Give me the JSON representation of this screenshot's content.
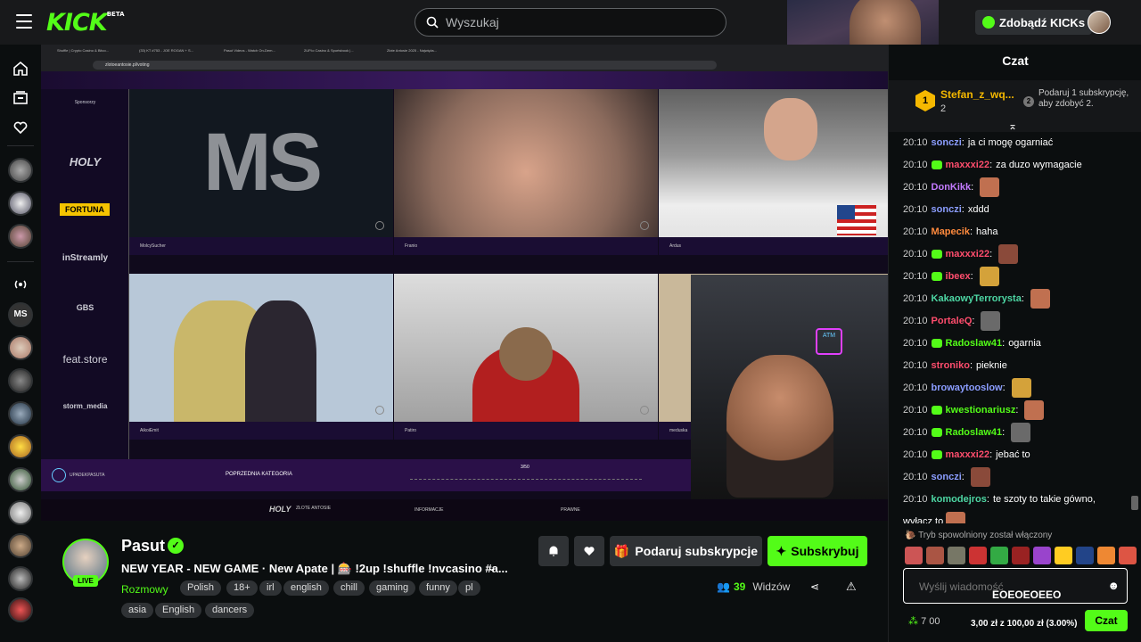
{
  "header": {
    "logo": "KICK",
    "logo_beta": "BETA",
    "search_placeholder": "Wyszukaj",
    "get_kicks": "Zdobądź KICKs"
  },
  "browser": {
    "tabs": [
      "Shuffle | Crypto Casino & Bitco...",
      "(33) KT #753 - JOE ROGAN + S...",
      "Pasut Videos - Watch On-Dem...",
      "2UP.io Casino & Sportsbook |...",
      "Złote Antosie 2025 - Najwięks..."
    ],
    "url": "zlotoeantosie.pl/voting"
  },
  "stream": {
    "sponsors_label": "Sponsorzy",
    "sponsors": [
      "HOLY",
      "FORTUNA",
      "inStreamly",
      "GBS",
      "feat.store",
      "storm_media"
    ],
    "big_logo": "MS",
    "cells": [
      "MolcySucher",
      "Franio",
      "Ardus",
      "AikoiEmit",
      "Patiro",
      "meduska"
    ],
    "prev_category": "POPRZEDNIA KATEGORIA",
    "page": "3/50",
    "channel_tag": "UPADEKPASUTA",
    "footer_info": "INFORMACJE",
    "footer_legal": "PRAWNE",
    "footer_logo": "HOLY",
    "footer_logo2": "ZŁOTE ANTOSIE"
  },
  "channel": {
    "name": "Pasut",
    "live": "LIVE",
    "title": "NEW YEAR - NEW GAME · New Apate | 🎰 !2up !shuffle !nvcasino #a...",
    "category": "Rozmowy",
    "tags": [
      "Polish",
      "18+",
      "irl",
      "english",
      "chill",
      "gaming",
      "funny",
      "pl",
      "asia",
      "English",
      "dancers"
    ],
    "gift_sub": "Podaruj subskrypcje",
    "subscribe": "Subskrybuj",
    "viewers_count": "39",
    "viewers_label": "Widzów"
  },
  "chat": {
    "title": "Czat",
    "pinned_user": "Stefan_z_wq...",
    "pinned_count": "2",
    "pinned_rank": "1",
    "pinned_gift": "Podaruj 1 subskrypcję, aby zdobyć 2.",
    "pinned_gift_badge": "2",
    "messages": [
      {
        "time": "20:10",
        "user": "sonczi",
        "color": "#8b9dff",
        "text": "ja ci mogę ogarniać",
        "emote": false,
        "badge": false
      },
      {
        "time": "20:10",
        "user": "maxxxi22",
        "color": "#ff4d6d",
        "text": "za duzo wymagacie",
        "emote": false,
        "badge": true
      },
      {
        "time": "20:10",
        "user": "DonKikk",
        "color": "#c47bff",
        "text": "",
        "emote": true,
        "badge": false
      },
      {
        "time": "20:10",
        "user": "sonczi",
        "color": "#8b9dff",
        "text": "xddd",
        "emote": false,
        "badge": false
      },
      {
        "time": "20:10",
        "user": "Mapecik",
        "color": "#ff8a3d",
        "text": "haha",
        "emote": false,
        "badge": false
      },
      {
        "time": "20:10",
        "user": "maxxxi22",
        "color": "#ff4d6d",
        "text": "",
        "emote": true,
        "badge": true
      },
      {
        "time": "20:10",
        "user": "ibeex",
        "color": "#ff4d6d",
        "text": "",
        "emote": true,
        "badge": true
      },
      {
        "time": "20:10",
        "user": "KakaowyTerrorysta",
        "color": "#4dd6a3",
        "text": "",
        "emote": true,
        "badge": false
      },
      {
        "time": "20:10",
        "user": "PortaleQ",
        "color": "#ff4d6d",
        "text": "",
        "emote": true,
        "badge": false
      },
      {
        "time": "20:10",
        "user": "Radoslaw41",
        "color": "#53fc18",
        "text": "ogarnia",
        "emote": false,
        "badge": true
      },
      {
        "time": "20:10",
        "user": "stroniko",
        "color": "#ff4d6d",
        "text": "pieknie",
        "emote": false,
        "badge": false
      },
      {
        "time": "20:10",
        "user": "browaytooslow",
        "color": "#8b9dff",
        "text": "",
        "emote": true,
        "badge": false
      },
      {
        "time": "20:10",
        "user": "kwestionariusz",
        "color": "#53fc18",
        "text": "",
        "emote": true,
        "badge": true
      },
      {
        "time": "20:10",
        "user": "Radoslaw41",
        "color": "#53fc18",
        "text": "",
        "emote": true,
        "badge": true
      },
      {
        "time": "20:10",
        "user": "maxxxi22",
        "color": "#ff4d6d",
        "text": "jebać to",
        "emote": false,
        "badge": true
      },
      {
        "time": "20:10",
        "user": "sonczi",
        "color": "#8b9dff",
        "text": "",
        "emote": true,
        "badge": false
      },
      {
        "time": "20:10",
        "user": "komodejros",
        "color": "#4dd6a3",
        "text": "te szoty to takie gówno,",
        "emote": false,
        "badge": false
      },
      {
        "time": "",
        "user": "",
        "color": "#ffffff",
        "text": "wyłącz to",
        "emote": true,
        "badge": false
      }
    ],
    "slow_mode": "Tryb spowolniony został włączony",
    "input_placeholder": "Wyślij wiadomość",
    "input_overlay": "EOEOEOEEO",
    "points": "7 00",
    "goal": "3,00 zł z 100,00 zł (3.00%)",
    "send": "Czat"
  }
}
